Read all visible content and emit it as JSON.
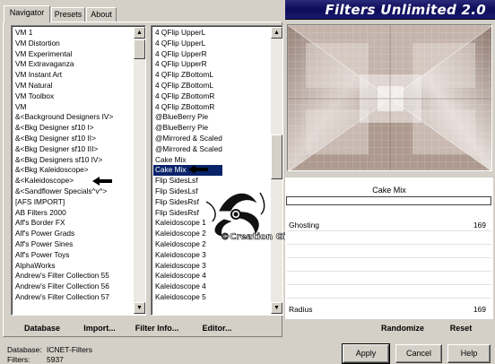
{
  "app": {
    "title": "Filters Unlimited 2.0"
  },
  "tabs": [
    {
      "label": "Navigator",
      "active": true
    },
    {
      "label": "Presets",
      "active": false
    },
    {
      "label": "About",
      "active": false
    }
  ],
  "categories": {
    "items": [
      "VM 1",
      "VM Distortion",
      "VM Experimental",
      "VM Extravaganza",
      "VM Instant Art",
      "VM Natural",
      "VM Toolbox",
      "VM",
      "&<Background Designers IV>",
      "&<Bkg Designer sf10 I>",
      "&<Bkg Designer sf10 II>",
      "&<Bkg Designer sf10 III>",
      "&<Bkg Designers sf10 IV>",
      "&<Bkg Kaleidoscope>",
      "&<Kaleidoscope>",
      "&<Sandflower Specials^v^>",
      "[AFS IMPORT]",
      "AB Filters 2000",
      "Alf's Border FX",
      "Alf's Power Grads",
      "Alf's Power Sines",
      "Alf's Power Toys",
      "AlphaWorks",
      "Andrew's Filter Collection 55",
      "Andrew's Filter Collection 56",
      "Andrew's Filter Collection 57"
    ]
  },
  "filters": {
    "items": [
      "4 QFlip UpperL",
      "4 QFlip UpperL",
      "4 QFlip UpperR",
      "4 QFlip UpperR",
      "4 QFlip ZBottomL",
      "4 QFlip ZBottomL",
      "4 QFlip ZBottomR",
      "4 QFlip ZBottomR",
      "@BlueBerry Pie",
      "@BlueBerry Pie",
      "@Mirrored & Scaled",
      "@Mirrored & Scaled",
      "Cake Mix",
      "Cake Mix",
      "Flip SidesLsf",
      "Flip SidesLsf",
      "Flip SidesRsf",
      "Flip SidesRsf",
      "Kaleidoscope 1",
      "Kaleidoscope 2",
      "Kaleidoscope 2",
      "Kaleidoscope 3",
      "Kaleidoscope 3",
      "Kaleidoscope 4",
      "Kaleidoscope 4",
      "Kaleidoscope 5"
    ],
    "selected_index": 13
  },
  "toolbar": {
    "database": "Database",
    "import": "Import...",
    "filter_info": "Filter Info...",
    "editor": "Editor..."
  },
  "params": {
    "filter_name": "Cake Mix",
    "sliders": [
      {
        "label": "Ghosting",
        "value": "169"
      },
      {
        "label": "Radius",
        "value": "169"
      }
    ],
    "randomize": "Randomize",
    "reset": "Reset"
  },
  "status": {
    "database_label": "Database:",
    "database_value": "ICNET-Filters",
    "filters_label": "Filters:",
    "filters_value": "5937"
  },
  "buttons": {
    "apply": "Apply",
    "cancel": "Cancel",
    "help": "Help"
  },
  "watermark": "©Creation Giocla",
  "colors": {
    "selection": "#0a246a",
    "banner": "#0c0c5a",
    "preview_base": "#b8a89e"
  }
}
